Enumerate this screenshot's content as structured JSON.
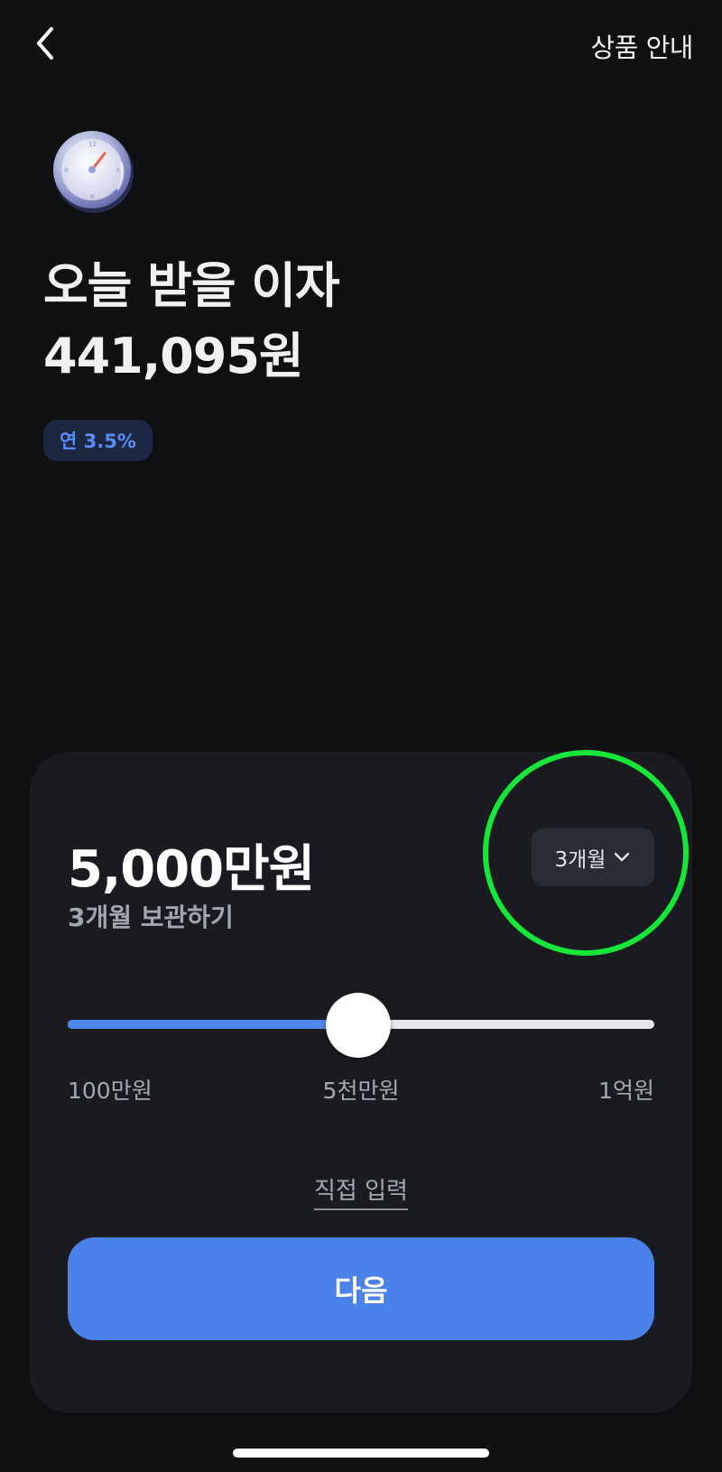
{
  "header": {
    "back_icon": "chevron-left-icon",
    "product_info_label": "상품 안내"
  },
  "hero": {
    "icon": "clock-icon",
    "title": "오늘 받을 이자",
    "interest_amount": "441,095원",
    "rate_badge": "연 3.5%"
  },
  "deposit_card": {
    "amount": "5,000만원",
    "caption": "3개월 보관하기",
    "period_select": {
      "value": "3개월",
      "icon": "chevron-down-icon"
    },
    "slider": {
      "min_label": "100만원",
      "mid_label": "5천만원",
      "max_label": "1억원",
      "fraction": 0.495
    },
    "direct_input_label": "직접 입력",
    "next_label": "다음"
  },
  "colors": {
    "background": "#0f1012",
    "card": "#1a1b20",
    "accent": "#4b82ea",
    "badge_text": "#5b8cf5",
    "highlight": "#16e53a"
  }
}
